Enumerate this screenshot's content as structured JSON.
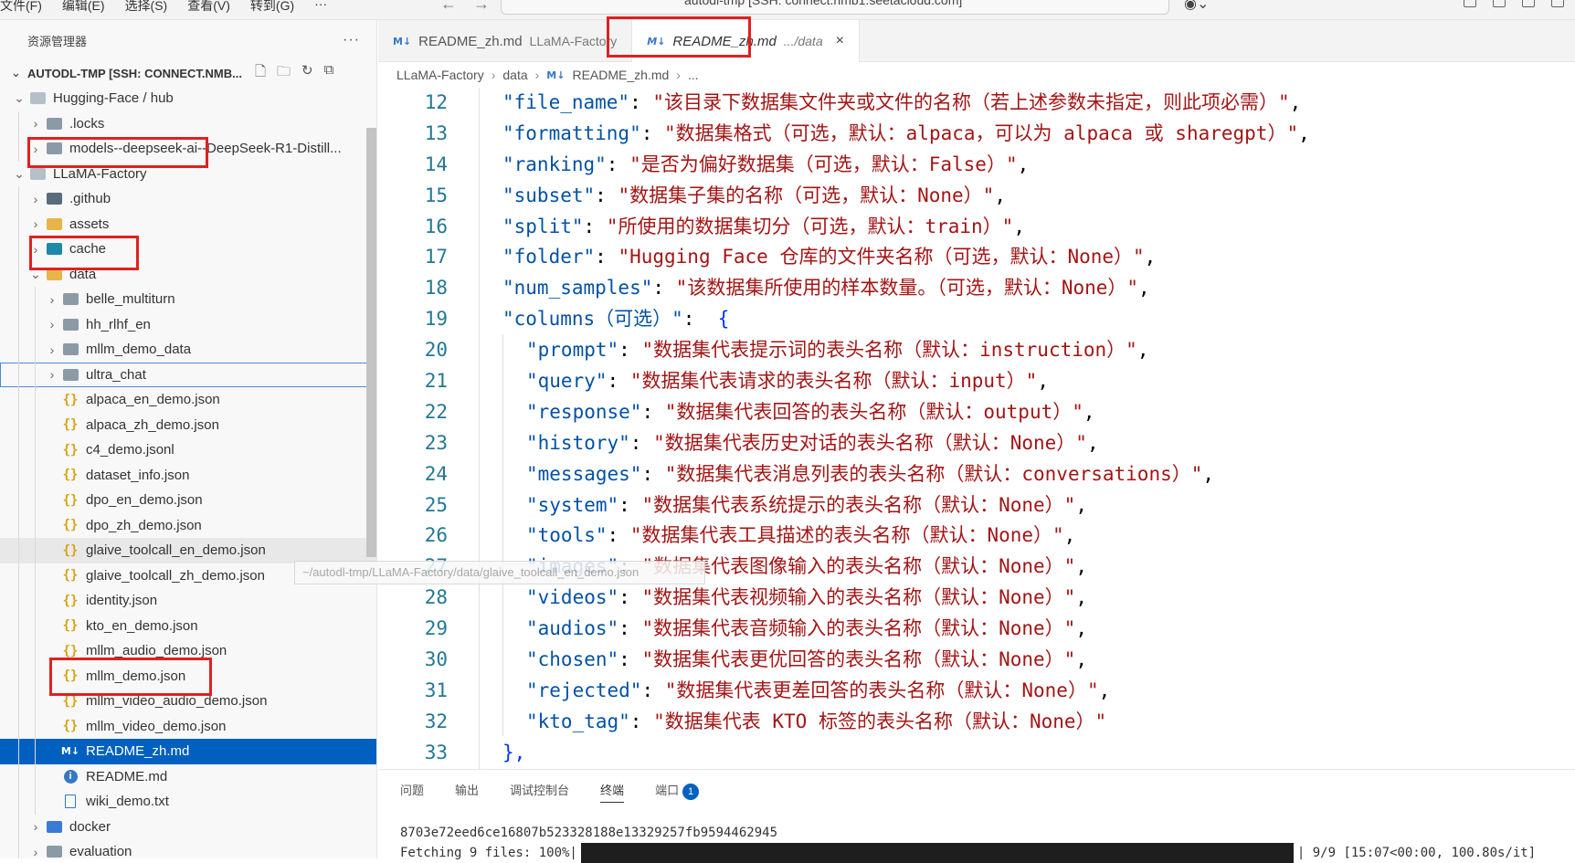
{
  "menu": [
    "文件(F)",
    "编辑(E)",
    "选择(S)",
    "查看(V)",
    "转到(G)",
    "···"
  ],
  "command_center": "autodl-tmp [SSH: connect.nmb1.seetacloud.com]",
  "sidebar": {
    "title": "资源管理器",
    "more": "···",
    "workspace": "AUTODL-TMP [SSH: CONNECT.NMB...",
    "tree": [
      {
        "label": "Hugging-Face / hub",
        "level": 1,
        "type": "folder-open",
        "twisty": "v"
      },
      {
        "label": ".locks",
        "level": 2,
        "type": "folder",
        "twisty": ">"
      },
      {
        "label": "models--deepseek-ai--DeepSeek-R1-Distill...",
        "level": 2,
        "type": "folder",
        "twisty": ">"
      },
      {
        "label": "LLaMA-Factory",
        "level": 1,
        "type": "folder-open",
        "twisty": "v"
      },
      {
        "label": ".github",
        "level": 2,
        "type": "folder-gh",
        "twisty": ">"
      },
      {
        "label": "assets",
        "level": 2,
        "type": "folder-yellow",
        "twisty": ">"
      },
      {
        "label": "cache",
        "level": 2,
        "type": "folder-teal",
        "twisty": ">"
      },
      {
        "label": "data",
        "level": 2,
        "type": "folder-yellow-open",
        "twisty": "v"
      },
      {
        "label": "belle_multiturn",
        "level": 3,
        "type": "folder",
        "twisty": ">"
      },
      {
        "label": "hh_rlhf_en",
        "level": 3,
        "type": "folder",
        "twisty": ">"
      },
      {
        "label": "mllm_demo_data",
        "level": 3,
        "type": "folder",
        "twisty": ">"
      },
      {
        "label": "ultra_chat",
        "level": 3,
        "type": "folder",
        "twisty": ">",
        "state": "focused"
      },
      {
        "label": "alpaca_en_demo.json",
        "level": 3,
        "type": "json"
      },
      {
        "label": "alpaca_zh_demo.json",
        "level": 3,
        "type": "json"
      },
      {
        "label": "c4_demo.jsonl",
        "level": 3,
        "type": "json"
      },
      {
        "label": "dataset_info.json",
        "level": 3,
        "type": "json"
      },
      {
        "label": "dpo_en_demo.json",
        "level": 3,
        "type": "json"
      },
      {
        "label": "dpo_zh_demo.json",
        "level": 3,
        "type": "json"
      },
      {
        "label": "glaive_toolcall_en_demo.json",
        "level": 3,
        "type": "json",
        "state": "hover"
      },
      {
        "label": "glaive_toolcall_zh_demo.json",
        "level": 3,
        "type": "json"
      },
      {
        "label": "identity.json",
        "level": 3,
        "type": "json"
      },
      {
        "label": "kto_en_demo.json",
        "level": 3,
        "type": "json"
      },
      {
        "label": "mllm_audio_demo.json",
        "level": 3,
        "type": "json"
      },
      {
        "label": "mllm_demo.json",
        "level": 3,
        "type": "json"
      },
      {
        "label": "mllm_video_audio_demo.json",
        "level": 3,
        "type": "json"
      },
      {
        "label": "mllm_video_demo.json",
        "level": 3,
        "type": "json"
      },
      {
        "label": "README_zh.md",
        "level": 3,
        "type": "md",
        "state": "selected"
      },
      {
        "label": "README.md",
        "level": 3,
        "type": "info"
      },
      {
        "label": "wiki_demo.txt",
        "level": 3,
        "type": "txt"
      },
      {
        "label": "docker",
        "level": 2,
        "type": "folder-blue",
        "twisty": ">"
      },
      {
        "label": "evaluation",
        "level": 2,
        "type": "folder",
        "twisty": ">"
      }
    ]
  },
  "tooltip": "~/autodl-tmp/LLaMA-Factory/data/glaive_toolcall_en_demo.json",
  "tabs": [
    {
      "label": "README_zh.md",
      "desc": "LLaMA-Factory",
      "active": false
    },
    {
      "label": "README_zh.md",
      "desc": ".../data",
      "active": true,
      "close": "×"
    }
  ],
  "breadcrumb": [
    "LLaMA-Factory",
    "data",
    "README_zh.md",
    "..."
  ],
  "editor": {
    "lines": [
      {
        "n": "12",
        "indent": 0,
        "key": "\"file_name\"",
        "val": "\"该目录下数据集文件夹或文件的名称（若上述参数未指定，则此项必需）\"",
        "end": ","
      },
      {
        "n": "13",
        "indent": 0,
        "key": "\"formatting\"",
        "val": "\"数据集格式（可选，默认：alpaca，可以为 alpaca 或 sharegpt）\"",
        "end": ","
      },
      {
        "n": "14",
        "indent": 0,
        "key": "\"ranking\"",
        "val": "\"是否为偏好数据集（可选，默认：False）\"",
        "end": ","
      },
      {
        "n": "15",
        "indent": 0,
        "key": "\"subset\"",
        "val": "\"数据集子集的名称（可选，默认：None）\"",
        "end": ","
      },
      {
        "n": "16",
        "indent": 0,
        "key": "\"split\"",
        "val": "\"所使用的数据集切分（可选，默认：train）\"",
        "end": ","
      },
      {
        "n": "17",
        "indent": 0,
        "key": "\"folder\"",
        "val": "\"Hugging Face 仓库的文件夹名称（可选，默认：None）\"",
        "end": ","
      },
      {
        "n": "18",
        "indent": 0,
        "key": "\"num_samples\"",
        "val": "\"该数据集所使用的样本数量。（可选，默认：None）\"",
        "end": ","
      },
      {
        "n": "19",
        "indent": 0,
        "key": "\"columns（可选）\"",
        "val": "",
        "end": " {"
      },
      {
        "n": "20",
        "indent": 1,
        "key": "\"prompt\"",
        "val": "\"数据集代表提示词的表头名称（默认：instruction）\"",
        "end": ","
      },
      {
        "n": "21",
        "indent": 1,
        "key": "\"query\"",
        "val": "\"数据集代表请求的表头名称（默认：input）\"",
        "end": ","
      },
      {
        "n": "22",
        "indent": 1,
        "key": "\"response\"",
        "val": "\"数据集代表回答的表头名称（默认：output）\"",
        "end": ","
      },
      {
        "n": "23",
        "indent": 1,
        "key": "\"history\"",
        "val": "\"数据集代表历史对话的表头名称（默认：None）\"",
        "end": ","
      },
      {
        "n": "24",
        "indent": 1,
        "key": "\"messages\"",
        "val": "\"数据集代表消息列表的表头名称（默认：conversations）\"",
        "end": ","
      },
      {
        "n": "25",
        "indent": 1,
        "key": "\"system\"",
        "val": "\"数据集代表系统提示的表头名称（默认：None）\"",
        "end": ","
      },
      {
        "n": "26",
        "indent": 1,
        "key": "\"tools\"",
        "val": "\"数据集代表工具描述的表头名称（默认：None）\"",
        "end": ","
      },
      {
        "n": "27",
        "indent": 1,
        "key": "\"images\"",
        "val": "\"数据集代表图像输入的表头名称（默认：None）\"",
        "end": ","
      },
      {
        "n": "28",
        "indent": 1,
        "key": "\"videos\"",
        "val": "\"数据集代表视频输入的表头名称（默认：None）\"",
        "end": ","
      },
      {
        "n": "29",
        "indent": 1,
        "key": "\"audios\"",
        "val": "\"数据集代表音频输入的表头名称（默认：None）\"",
        "end": ","
      },
      {
        "n": "30",
        "indent": 1,
        "key": "\"chosen\"",
        "val": "\"数据集代表更优回答的表头名称（默认：None）\"",
        "end": ","
      },
      {
        "n": "31",
        "indent": 1,
        "key": "\"rejected\"",
        "val": "\"数据集代表更差回答的表头名称（默认：None）\"",
        "end": ","
      },
      {
        "n": "32",
        "indent": 1,
        "key": "\"kto_tag\"",
        "val": "\"数据集代表 KTO 标签的表头名称（默认：None）\"",
        "end": ""
      },
      {
        "n": "33",
        "indent": 0,
        "key": "",
        "val": "",
        "end": "},"
      }
    ]
  },
  "panel": {
    "tabs": [
      "问题",
      "输出",
      "调试控制台",
      "终端",
      "端口"
    ],
    "active_tab": "终端",
    "ports_badge": "1",
    "terminal": {
      "line1": "8703e72eed6ce16807b523328188e13329257fb9594462945",
      "line2_prefix": "Fetching 9 files: 100%|",
      "line2_suffix": "| 9/9 [15:07<00:00, 100.80s/it]"
    }
  },
  "colors": {
    "accent": "#0060c0",
    "highlight_box": "#e02020",
    "json_key": "#0451a5",
    "json_string": "#a31515"
  }
}
